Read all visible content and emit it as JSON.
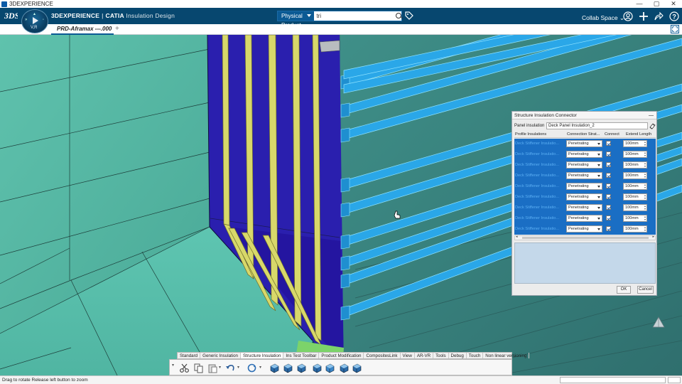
{
  "window": {
    "title": "3DEXPERIENCE",
    "controls": [
      "—",
      "▢",
      "✕"
    ]
  },
  "topbar": {
    "brand_main": "3DEXPERIENCE",
    "brand_sep": "|",
    "brand_product": "CATIA",
    "brand_app": "Insulation Design",
    "search_scope": "Physical Product",
    "search_value": "tri",
    "collab_space": "Collab Space",
    "compass_label": "V,R"
  },
  "tabs": {
    "active": "PRD-Aframax ---.000",
    "add": "+"
  },
  "dialog": {
    "title": "Structure Insulation Connector",
    "minimize": "—",
    "panel_label": "Panel insulation",
    "panel_value": "Deck Panel Insulation_2",
    "columns": [
      "Profile Insulations",
      "Connection Strat...",
      "Connect",
      "Extend Length"
    ],
    "rows": [
      {
        "name": "Deck Stiffener Insulatio...",
        "type": "Penetrating",
        "connect": true,
        "length": "100mm"
      },
      {
        "name": "Deck Stiffener Insulatio...",
        "type": "Penetrating",
        "connect": true,
        "length": "100mm"
      },
      {
        "name": "Deck Stiffener Insulatio...",
        "type": "Penetrating",
        "connect": true,
        "length": "100mm"
      },
      {
        "name": "Deck Stiffener Insulatio...",
        "type": "Penetrating",
        "connect": true,
        "length": "100mm"
      },
      {
        "name": "Deck Stiffener Insulatio...",
        "type": "Penetrating",
        "connect": true,
        "length": "100mm"
      },
      {
        "name": "Deck Stiffener Insulatio...",
        "type": "Penetrating",
        "connect": true,
        "length": "100mm"
      },
      {
        "name": "Deck Stiffener Insulatio...",
        "type": "Penetrating",
        "connect": true,
        "length": "100mm"
      },
      {
        "name": "Deck Stiffener Insulatio...",
        "type": "Penetrating",
        "connect": true,
        "length": "100mm"
      },
      {
        "name": "Deck Stiffener Insulatio...",
        "type": "Penetrating",
        "connect": true,
        "length": "100mm"
      }
    ],
    "ok": "OK",
    "cancel": "Cancel"
  },
  "actionbar": {
    "tabs": [
      "Standard",
      "Generic Insulation",
      "Structure Insulation",
      "Ins Test Toolbar",
      "Product Modification",
      "CompositesLink",
      "View",
      "AR-VR",
      "Tools",
      "Debug",
      "Touch",
      "Non linear versioning"
    ],
    "active_tab": "Structure Insulation",
    "tools": [
      "cut-icon",
      "copy-icon",
      "paste-icon",
      "undo-icon",
      "update-icon",
      "panel-insulation-icon",
      "profile-insulation-icon",
      "connector-icon",
      "wrap-icon",
      "box-insulation-icon",
      "structure-connector-icon",
      "extend-icon"
    ]
  },
  "statusbar": {
    "text": "Drag to rotate  Release left button to zoom"
  },
  "colors": {
    "topbar": "#07476f",
    "accent": "#0b5a94",
    "hull_teal": "#4fb3a1",
    "bulkhead_blue": "#2a1fb0",
    "stiffener_yellow": "#d9d96a",
    "profile_cyan": "#2aa7e8"
  }
}
